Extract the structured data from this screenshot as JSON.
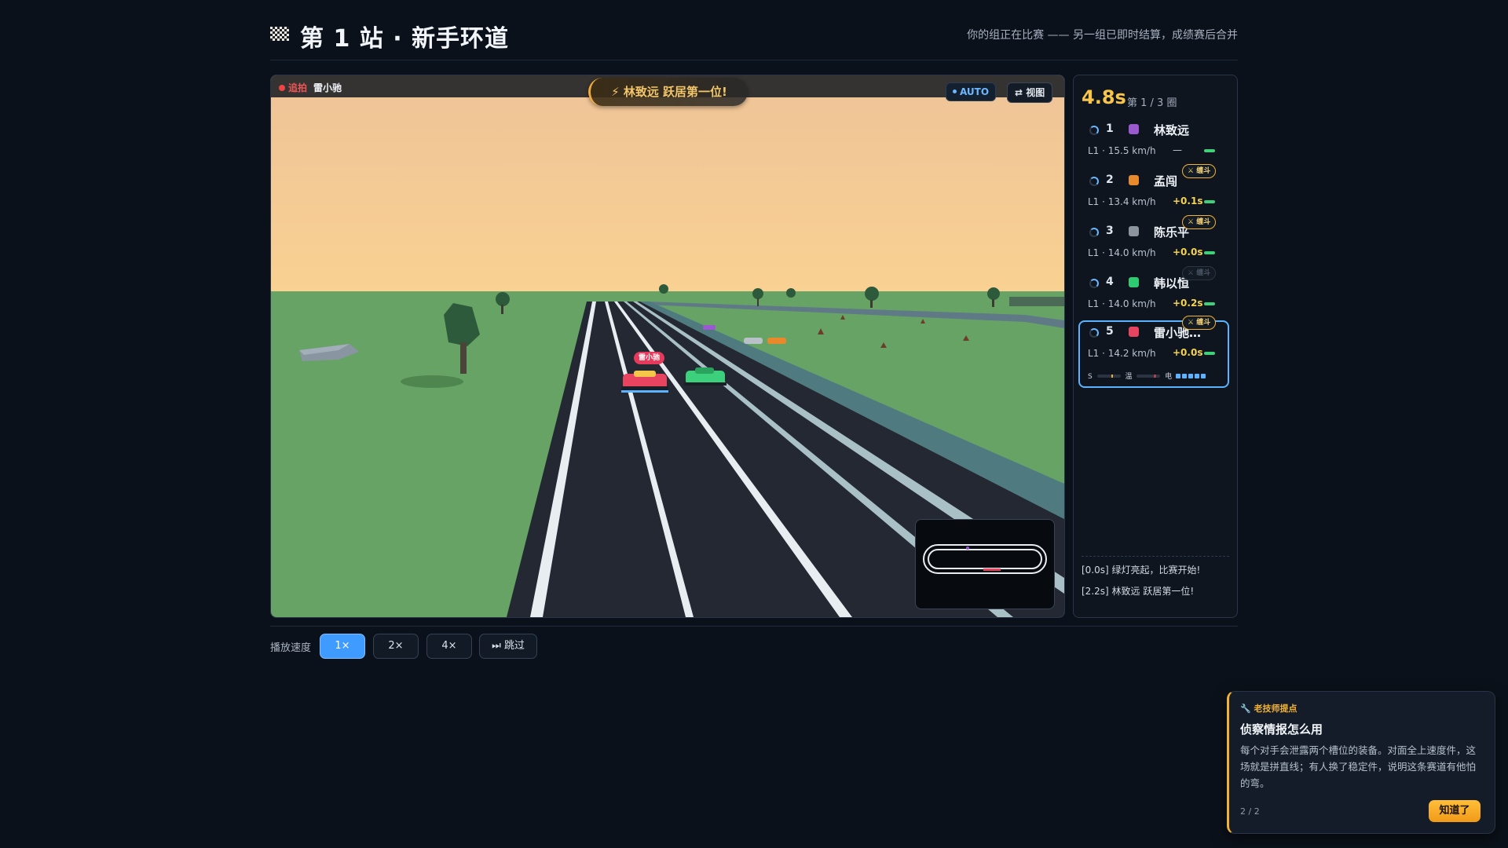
{
  "header": {
    "title": "第 1 站 · 新手环道",
    "subtitle": "你的组正在比赛 —— 另一组已即时结算，成绩赛后合并"
  },
  "stage": {
    "chase_tag": "追拍",
    "chase_driver": "雷小驰",
    "banner": "⚡ 林致远 跃居第一位!",
    "auto_label": "AUTO",
    "view_label": "⇄ 视图",
    "car_label": "雷小驰"
  },
  "standings": {
    "timer": "4.8s",
    "lap": "第 1 / 3 圈",
    "rows": [
      {
        "rank": "1",
        "name": "林致远",
        "color": "#9b59d0",
        "stat": "L1 · 15.5 km/h",
        "gap": "—",
        "duel": ""
      },
      {
        "rank": "2",
        "name": "孟闯",
        "color": "#e8892c",
        "stat": "L1 · 13.4 km/h",
        "gap": "+0.1s",
        "duel": "⚔ 缠斗"
      },
      {
        "rank": "3",
        "name": "陈乐平",
        "color": "#8c949e",
        "stat": "L1 · 14.0 km/h",
        "gap": "+0.0s",
        "duel": "⚔ 缠斗"
      },
      {
        "rank": "4",
        "name": "韩以恒",
        "color": "#2ecc71",
        "stat": "L1 · 14.0 km/h",
        "gap": "+0.2s",
        "duel": "⚔ 缠斗"
      },
      {
        "rank": "5",
        "name": "雷小驰…",
        "color": "#e8445f",
        "stat": "L1 · 14.2 km/h",
        "gap": "+0.0s",
        "duel": "⚔ 缠斗"
      }
    ],
    "meter": {
      "s": "S",
      "temp": "温",
      "elec": "电"
    },
    "log": [
      "[0.0s] 绿灯亮起，比赛开始!",
      "[2.2s] 林致远 跃居第一位!"
    ]
  },
  "speed": {
    "label": "播放速度",
    "buttons": [
      "1×",
      "2×",
      "4×",
      "⏭ 跳过"
    ]
  },
  "tip": {
    "kicker": "🔧 老技师提点",
    "title": "侦察情报怎么用",
    "body": "每个对手会泄露两个槽位的装备。对面全上速度件，这场就是拼直线；有人换了稳定件，说明这条赛道有他怕的弯。",
    "page": "2 / 2",
    "ok": "知道了"
  }
}
